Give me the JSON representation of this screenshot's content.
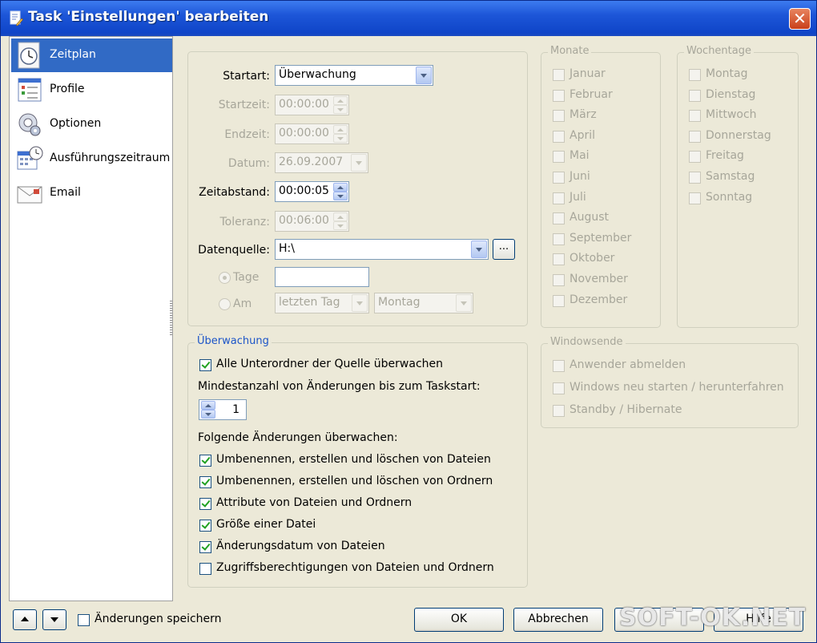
{
  "window": {
    "title": "Task 'Einstellungen' bearbeiten",
    "close_glyph": "✕"
  },
  "sidebar": {
    "items": [
      {
        "label": "Zeitplan",
        "icon": "clock-icon",
        "active": true
      },
      {
        "label": "Profile",
        "icon": "profile-list-icon",
        "active": false
      },
      {
        "label": "Optionen",
        "icon": "options-icon",
        "active": false
      },
      {
        "label": "Ausführungszeitraum",
        "icon": "calendar-clock-icon",
        "active": false
      },
      {
        "label": "Email",
        "icon": "email-icon",
        "active": false
      }
    ]
  },
  "schedule": {
    "startart_label": "Startart:",
    "startart_value": "Überwachung",
    "startzeit_label": "Startzeit:",
    "startzeit_value": "00:00:00",
    "endzeit_label": "Endzeit:",
    "endzeit_value": "00:00:00",
    "datum_label": "Datum:",
    "datum_value": "26.09.2007",
    "zeitabstand_label": "Zeitabstand:",
    "zeitabstand_value": "00:00:05",
    "toleranz_label": "Toleranz:",
    "toleranz_value": "00:06:00",
    "datenquelle_label": "Datenquelle:",
    "datenquelle_value": "H:\\",
    "browse_label": "...",
    "tage_label": "Tage",
    "tage_value": "",
    "am_label": "Am",
    "am_day_value": "letzten Tag",
    "am_weekday_value": "Montag"
  },
  "monate": {
    "legend": "Monate",
    "items": [
      "Januar",
      "Februar",
      "März",
      "April",
      "Mai",
      "Juni",
      "Juli",
      "August",
      "September",
      "Oktober",
      "November",
      "Dezember"
    ]
  },
  "wochentage": {
    "legend": "Wochentage",
    "items": [
      "Montag",
      "Dienstag",
      "Mittwoch",
      "Donnerstag",
      "Freitag",
      "Samstag",
      "Sonntag"
    ]
  },
  "ueberwachung": {
    "legend": "Überwachung",
    "subfolders_label": "Alle Unterordner der Quelle überwachen",
    "subfolders_checked": true,
    "min_changes_label": "Mindestanzahl von Änderungen bis zum Taskstart:",
    "min_changes_value": "1",
    "watch_label": "Folgende Änderungen überwachen:",
    "changes": [
      {
        "label": "Umbenennen, erstellen und löschen von Dateien",
        "checked": true
      },
      {
        "label": "Umbenennen, erstellen und löschen von Ordnern",
        "checked": true
      },
      {
        "label": "Attribute von Dateien und Ordnern",
        "checked": true
      },
      {
        "label": "Größe einer Datei",
        "checked": true
      },
      {
        "label": "Änderungsdatum von Dateien",
        "checked": true
      },
      {
        "label": "Zugriffsberechtigungen von Dateien und Ordnern",
        "checked": false
      }
    ]
  },
  "windowsende": {
    "legend": "Windowsende",
    "items": [
      "Anwender abmelden",
      "Windows neu starten / herunterfahren",
      "Standby / Hibernate"
    ]
  },
  "footer": {
    "save_changes_label": "Änderungen speichern",
    "ok_label": "OK",
    "cancel_label": "Abbrechen",
    "help_label": "Hilfe"
  },
  "watermark": "SOFT-OK.NET",
  "colors": {
    "titlebar": "#1d56d8",
    "selection": "#316ac5",
    "dialog_bg": "#ece9d8",
    "disabled_text": "#a7a69a",
    "legend_blue": "#1c55c8",
    "check_green": "#21a121"
  }
}
